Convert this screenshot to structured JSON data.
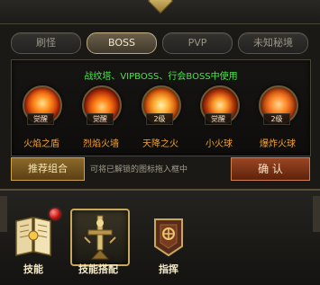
{
  "tabs": [
    {
      "label": "刷怪"
    },
    {
      "label": "BOSS"
    },
    {
      "label": "PVP"
    },
    {
      "label": "未知秘境"
    }
  ],
  "panel": {
    "note": "战纹塔、VIPBOSS、行会BOSS中使用"
  },
  "skills": [
    {
      "name": "火焰之盾",
      "badge": "觉醒",
      "icon": "fire-shield-icon"
    },
    {
      "name": "烈焰火墙",
      "badge": "觉醒",
      "icon": "flame-wall-icon"
    },
    {
      "name": "天降之火",
      "badge": "2级",
      "icon": "falling-fire-icon"
    },
    {
      "name": "小火球",
      "badge": "觉醒",
      "icon": "small-fireball-icon"
    },
    {
      "name": "爆炸火球",
      "badge": "2级",
      "icon": "explosion-fireball-icon"
    }
  ],
  "actions": {
    "recommend_label": "推荐组合",
    "hint": "可将已解锁的图标拖入框中",
    "confirm_label": "确 认"
  },
  "bottom_nav": [
    {
      "label": "技能",
      "icon": "skill-book-icon"
    },
    {
      "label": "技能搭配",
      "icon": "sword-emblem-icon"
    },
    {
      "label": "指挥",
      "icon": "command-banner-icon"
    }
  ],
  "colors": {
    "accent_gold": "#c8a85a",
    "note_green": "#4ce34a",
    "skill_name_orange": "#f0a233"
  }
}
